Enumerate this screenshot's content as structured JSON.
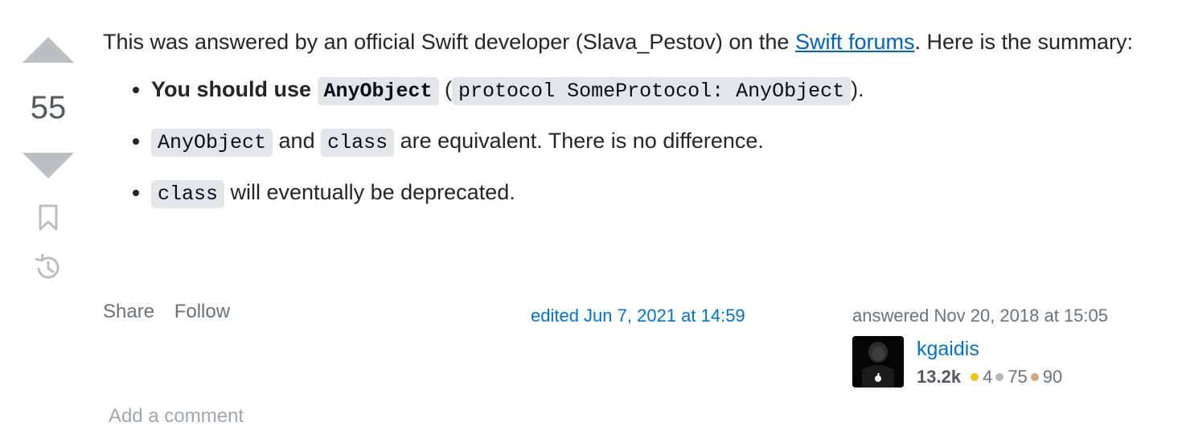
{
  "vote": {
    "count": "55"
  },
  "post": {
    "intro_before": "This was answered by an official Swift developer (Slava_Pestov) on the ",
    "intro_link": "Swift forums",
    "intro_after": ". Here is the summary:",
    "bullets": [
      {
        "bold": "You should use ",
        "code1": "AnyObject",
        "mid": " (",
        "code2": "protocol SomeProtocol: AnyObject",
        "end": ")."
      },
      {
        "code1": "AnyObject",
        "mid": " and ",
        "code2": "class",
        "end": " are equivalent. There is no difference."
      },
      {
        "code1": "class",
        "end": " will eventually be deprecated."
      }
    ]
  },
  "actions": {
    "share": "Share",
    "follow": "Follow"
  },
  "edited": "edited Jun 7, 2021 at 14:59",
  "author": {
    "answered": "answered Nov 20, 2018 at 15:05",
    "name": "kgaidis",
    "reputation": "13.2k",
    "gold": "4",
    "silver": "75",
    "bronze": "90"
  },
  "add_comment": "Add a comment",
  "colors": {
    "gold": "#f1c40f",
    "silver": "#b4b8bc",
    "bronze": "#d1a684",
    "link": "#0063bf"
  }
}
